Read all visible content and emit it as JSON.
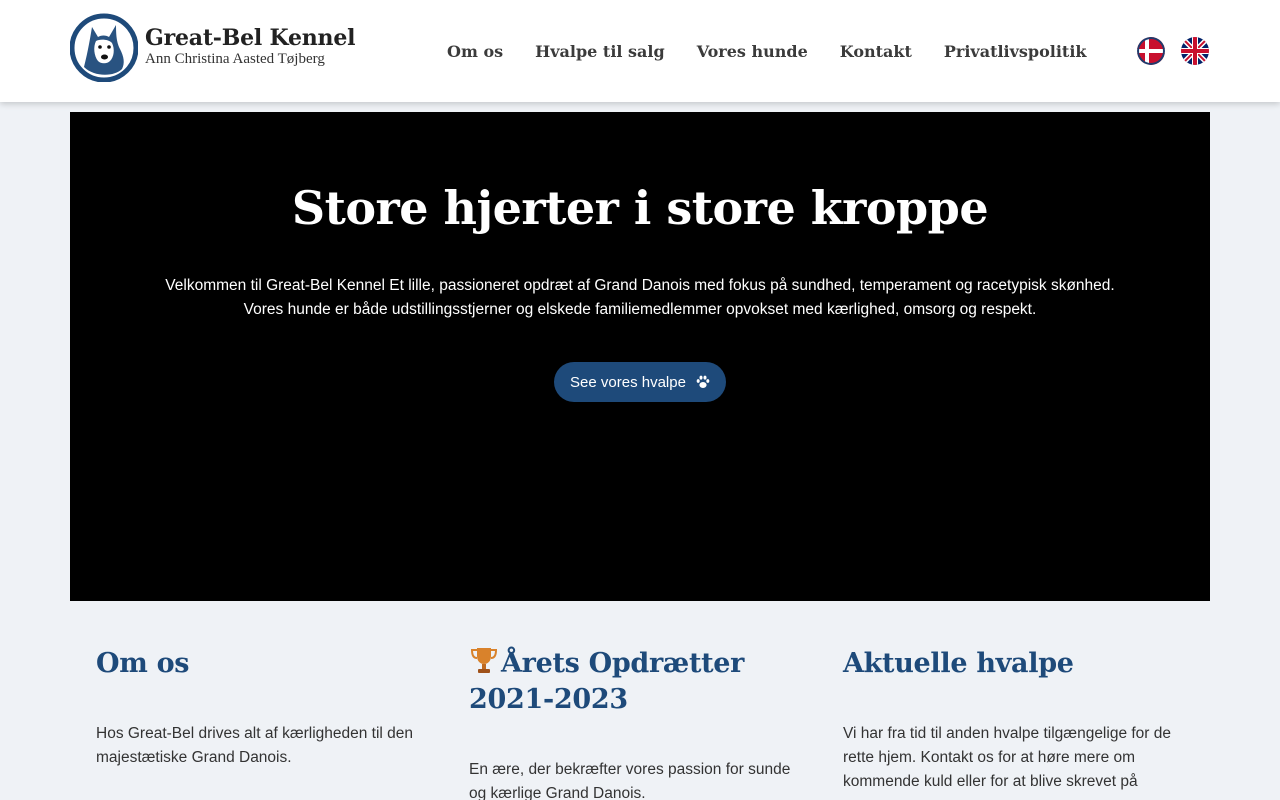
{
  "header": {
    "logo": {
      "title": "Great-Bel Kennel",
      "subtitle": "Ann Christina Aasted Tøjberg"
    },
    "nav": [
      {
        "label": "Om os"
      },
      {
        "label": "Hvalpe til salg"
      },
      {
        "label": "Vores hunde"
      },
      {
        "label": "Kontakt"
      },
      {
        "label": "Privatlivspolitik"
      }
    ],
    "languages": [
      {
        "icon": "danish-flag-icon"
      },
      {
        "icon": "uk-flag-icon"
      }
    ]
  },
  "hero": {
    "title": "Store hjerter i store kroppe",
    "text": "Velkommen til Great-Bel Kennel Et lille, passioneret opdræt af Grand Danois med fokus på sundhed, temperament og racetypisk skønhed. Vores hunde er både udstillingsstjerner og elskede familiemedlemmer opvokset med kærlighed, omsorg og respekt.",
    "cta_label": "See vores hvalpe",
    "cta_icon": "paw-icon"
  },
  "sections": [
    {
      "title": "Om os",
      "text": "Hos Great-Bel drives alt af kærligheden til den majestætiske Grand Danois."
    },
    {
      "icon": "trophy-icon",
      "title": "Årets Opdrætter 2021-2023",
      "text": "En ære, der bekræfter vores passion for sunde og kærlige Grand Danois."
    },
    {
      "title": "Aktuelle hvalpe",
      "text": "Vi har fra tid til anden hvalpe tilgængelige for de rette hjem.  Kontakt os for at høre mere om kommende kuld eller for at blive skrevet på"
    }
  ],
  "colors": {
    "accent": "#1e4a7a",
    "background": "#eff2f6",
    "hero_background": "#000000"
  }
}
